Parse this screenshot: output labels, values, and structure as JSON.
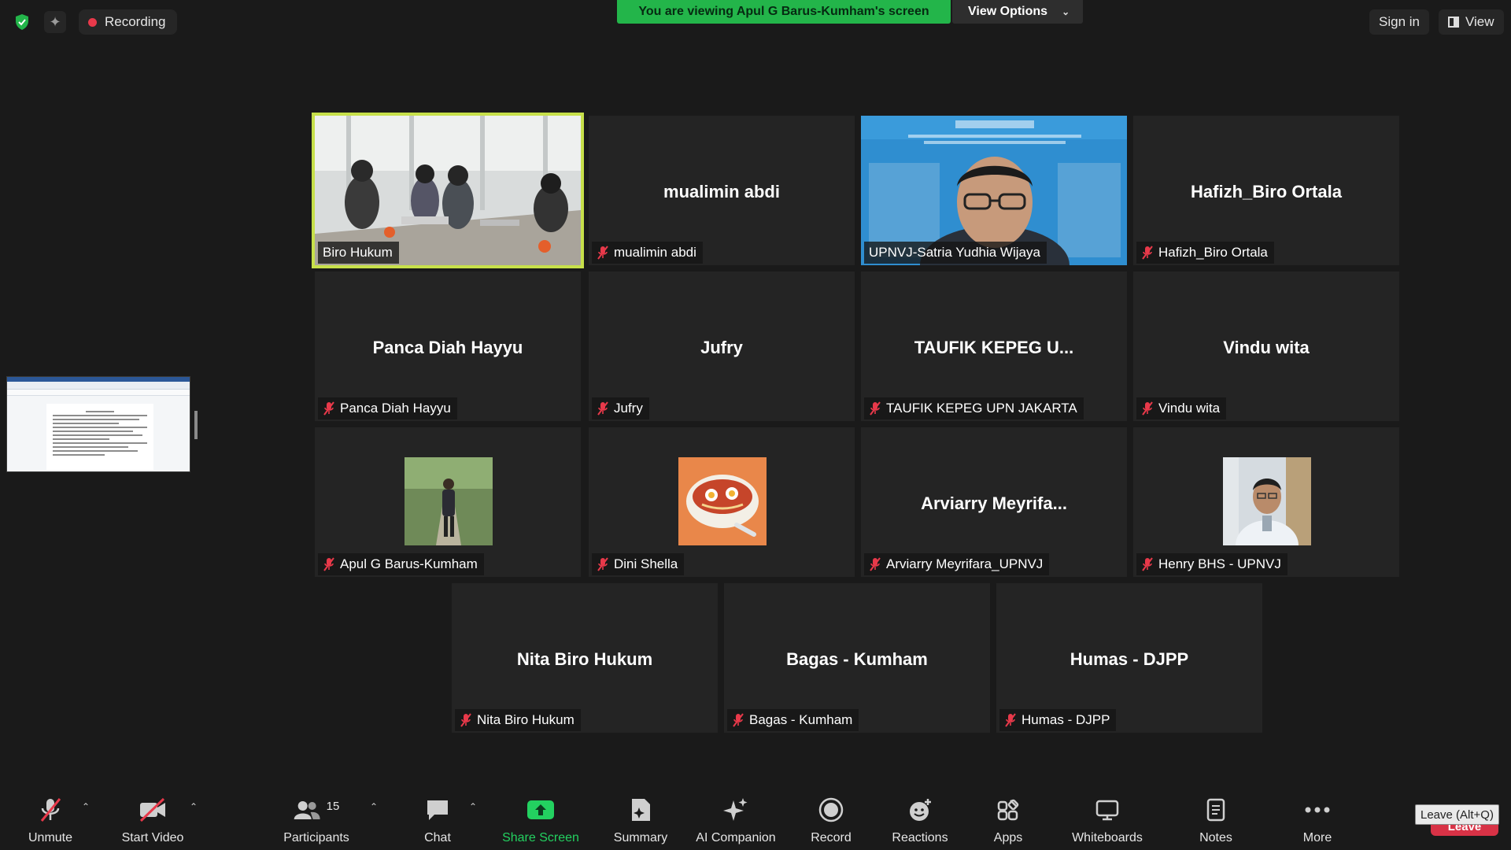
{
  "topbar": {
    "recording_label": "Recording",
    "viewing_banner": "You are viewing Apul G Barus-Kumham's screen",
    "view_options_label": "View Options",
    "sign_in_label": "Sign in",
    "view_label": "View"
  },
  "tiles": [
    {
      "big_name": "",
      "tag": "Biro Hukum",
      "muted": false,
      "active": true,
      "media": "video-room"
    },
    {
      "big_name": "mualimin abdi",
      "tag": "mualimin abdi",
      "muted": true,
      "active": false,
      "media": "none"
    },
    {
      "big_name": "",
      "tag": "UPNVJ-Satria Yudhia Wijaya",
      "muted": false,
      "active": false,
      "media": "video-person"
    },
    {
      "big_name": "Hafizh_Biro Ortala",
      "tag": "Hafizh_Biro Ortala",
      "muted": true,
      "active": false,
      "media": "none"
    },
    {
      "big_name": "Panca Diah Hayyu",
      "tag": "Panca Diah Hayyu",
      "muted": true,
      "active": false,
      "media": "none"
    },
    {
      "big_name": "Jufry",
      "tag": "Jufry",
      "muted": true,
      "active": false,
      "media": "none"
    },
    {
      "big_name": "TAUFIK KEPEG U...",
      "tag": "TAUFIK KEPEG UPN JAKARTA",
      "muted": true,
      "active": false,
      "media": "none"
    },
    {
      "big_name": "Vindu wita",
      "tag": "Vindu wita",
      "muted": true,
      "active": false,
      "media": "none"
    },
    {
      "big_name": "",
      "tag": "Apul G Barus-Kumham",
      "muted": true,
      "active": false,
      "media": "avatar-park"
    },
    {
      "big_name": "",
      "tag": "Dini Shella",
      "muted": true,
      "active": false,
      "media": "avatar-bowl"
    },
    {
      "big_name": "Arviarry  Meyrifa...",
      "tag": "Arviarry Meyrifara_UPNVJ",
      "muted": true,
      "active": false,
      "media": "none"
    },
    {
      "big_name": "",
      "tag": "Henry BHS - UPNVJ",
      "muted": true,
      "active": false,
      "media": "avatar-man"
    },
    {
      "big_name": "Nita Biro Hukum",
      "tag": "Nita Biro Hukum",
      "muted": true,
      "active": false,
      "media": "none"
    },
    {
      "big_name": "Bagas - Kumham",
      "tag": "Bagas - Kumham",
      "muted": true,
      "active": false,
      "media": "none"
    },
    {
      "big_name": "Humas - DJPP",
      "tag": "Humas - DJPP",
      "muted": true,
      "active": false,
      "media": "none"
    }
  ],
  "toolbar": {
    "unmute": "Unmute",
    "start_video": "Start Video",
    "participants": "Participants",
    "participants_count": "15",
    "chat": "Chat",
    "share_screen": "Share Screen",
    "summary": "Summary",
    "ai_companion": "AI Companion",
    "record": "Record",
    "reactions": "Reactions",
    "apps": "Apps",
    "whiteboards": "Whiteboards",
    "notes": "Notes",
    "more": "More",
    "leave_tooltip": "Leave (Alt+Q)",
    "leave": "Leave"
  },
  "colors": {
    "background": "#1a1a1a",
    "tile": "#242424",
    "active_speaker_border": "#c7e04a",
    "banner_green": "#23b54a",
    "share_screen_green": "#23d160",
    "leave_red": "#d83246",
    "mute_red": "#e8394a"
  }
}
